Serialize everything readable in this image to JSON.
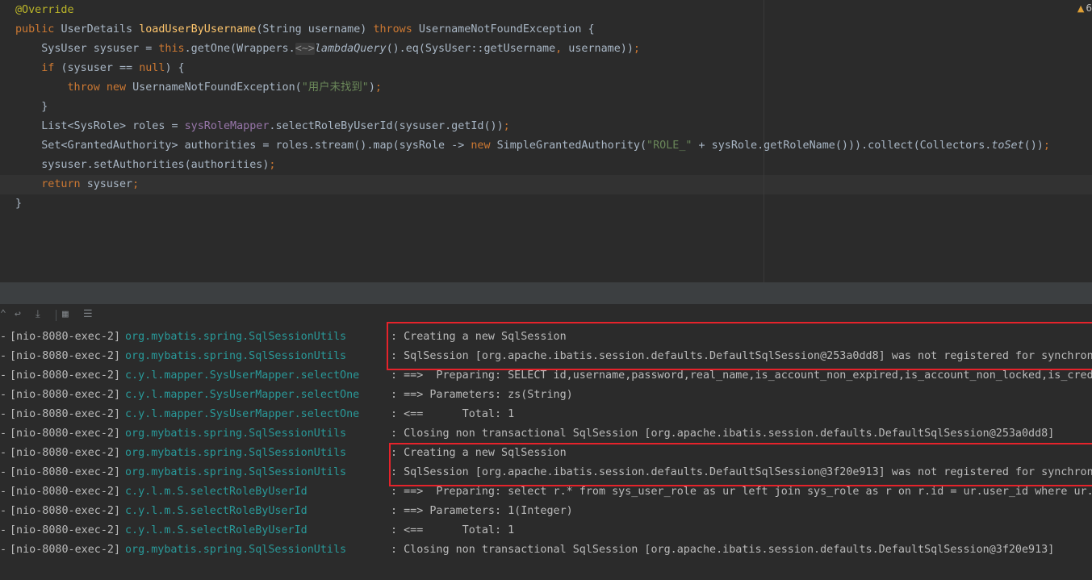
{
  "editor": {
    "inspection_count": "6",
    "code_lines": [
      [
        {
          "t": "@Override",
          "c": "tok-annotation"
        }
      ],
      [
        {
          "t": "public ",
          "c": "tok-kw"
        },
        {
          "t": "UserDetails "
        },
        {
          "t": "loadUserByUsername",
          "c": "tok-fn"
        },
        {
          "t": "(String username) "
        },
        {
          "t": "throws ",
          "c": "tok-kw"
        },
        {
          "t": "UsernameNotFoundException {"
        }
      ],
      [
        {
          "t": "    SysUser sysuser = "
        },
        {
          "t": "this",
          "c": "tok-kw"
        },
        {
          "t": ".getOne(Wrappers."
        },
        {
          "t": "<~>",
          "c": "tok-diamond"
        },
        {
          "t": "lambdaQuery",
          "c": "tok-it"
        },
        {
          "t": "().eq(SysUser::getUsername"
        },
        {
          "t": ", ",
          "c": "tok-kw"
        },
        {
          "t": "username))"
        },
        {
          "t": ";",
          "c": "tok-kw"
        }
      ],
      [
        {
          "t": "    "
        },
        {
          "t": "if ",
          "c": "tok-kw"
        },
        {
          "t": "(sysuser == "
        },
        {
          "t": "null",
          "c": "tok-kw"
        },
        {
          "t": ") {"
        }
      ],
      [
        {
          "t": "        "
        },
        {
          "t": "throw new ",
          "c": "tok-kw"
        },
        {
          "t": "UsernameNotFoundException("
        },
        {
          "t": "\"用户未找到\"",
          "c": "tok-str"
        },
        {
          "t": ")"
        },
        {
          "t": ";",
          "c": "tok-kw"
        }
      ],
      [
        {
          "t": "    }"
        }
      ],
      [
        {
          "t": "    List<SysRole> roles = "
        },
        {
          "t": "sysRoleMapper",
          "c": "tok-field"
        },
        {
          "t": ".selectRoleByUserId(sysuser.getId())"
        },
        {
          "t": ";",
          "c": "tok-kw"
        }
      ],
      [
        {
          "t": "    Set<GrantedAuthority> authorities = roles.stream().map(sysRole -> "
        },
        {
          "t": "new ",
          "c": "tok-kw"
        },
        {
          "t": "SimpleGrantedAuthority("
        },
        {
          "t": "\"ROLE_\"",
          "c": "tok-str"
        },
        {
          "t": " + sysRole.getRoleName())).collect(Collectors."
        },
        {
          "t": "toSet",
          "c": "tok-it"
        },
        {
          "t": "())"
        },
        {
          "t": ";",
          "c": "tok-kw"
        }
      ],
      [
        {
          "t": "    sysuser.setAuthorities(authorities)"
        },
        {
          "t": ";",
          "c": "tok-kw"
        }
      ],
      [
        {
          "t": "    "
        },
        {
          "t": "return ",
          "c": "tok-kw"
        },
        {
          "t": "sysuser"
        },
        {
          "t": ";",
          "c": "tok-kw"
        }
      ],
      [
        {
          "t": "}"
        }
      ]
    ]
  },
  "console": {
    "toolbar_icons": [
      "scroll-up-icon",
      "soft-wrap-icon",
      "scroll-to-end-icon",
      "print-icon",
      "clear-all-icon"
    ],
    "log_lines": [
      {
        "prefix": "-",
        "thread": "[nio-8080-exec-2]",
        "logger": "org.mybatis.spring.SqlSessionUtils",
        "message": ": Creating a new SqlSession"
      },
      {
        "prefix": "-",
        "thread": "[nio-8080-exec-2]",
        "logger": "org.mybatis.spring.SqlSessionUtils",
        "message": ": SqlSession [org.apache.ibatis.session.defaults.DefaultSqlSession@253a0dd8] was not registered for synchroni"
      },
      {
        "prefix": "-",
        "thread": "[nio-8080-exec-2]",
        "logger": "c.y.l.mapper.SysUserMapper.selectOne",
        "message": ": ==>  Preparing: SELECT id,username,password,real_name,is_account_non_expired,is_account_non_locked,is_crede"
      },
      {
        "prefix": "-",
        "thread": "[nio-8080-exec-2]",
        "logger": "c.y.l.mapper.SysUserMapper.selectOne",
        "message": ": ==> Parameters: zs(String)"
      },
      {
        "prefix": "-",
        "thread": "[nio-8080-exec-2]",
        "logger": "c.y.l.mapper.SysUserMapper.selectOne",
        "message": ": <==      Total: 1"
      },
      {
        "prefix": "-",
        "thread": "[nio-8080-exec-2]",
        "logger": "org.mybatis.spring.SqlSessionUtils",
        "message": ": Closing non transactional SqlSession [org.apache.ibatis.session.defaults.DefaultSqlSession@253a0dd8]"
      },
      {
        "prefix": "-",
        "thread": "[nio-8080-exec-2]",
        "logger": "org.mybatis.spring.SqlSessionUtils",
        "message": ": Creating a new SqlSession"
      },
      {
        "prefix": "-",
        "thread": "[nio-8080-exec-2]",
        "logger": "org.mybatis.spring.SqlSessionUtils",
        "message": ": SqlSession [org.apache.ibatis.session.defaults.DefaultSqlSession@3f20e913] was not registered for synchroni"
      },
      {
        "prefix": "-",
        "thread": "[nio-8080-exec-2]",
        "logger": "c.y.l.m.S.selectRoleByUserId",
        "message": ": ==>  Preparing: select r.* from sys_user_role as ur left join sys_role as r on r.id = ur.user_id where ur.u"
      },
      {
        "prefix": "-",
        "thread": "[nio-8080-exec-2]",
        "logger": "c.y.l.m.S.selectRoleByUserId",
        "message": ": ==> Parameters: 1(Integer)"
      },
      {
        "prefix": "-",
        "thread": "[nio-8080-exec-2]",
        "logger": "c.y.l.m.S.selectRoleByUserId",
        "message": ": <==      Total: 1"
      },
      {
        "prefix": "-",
        "thread": "[nio-8080-exec-2]",
        "logger": "org.mybatis.spring.SqlSessionUtils",
        "message": ": Closing non transactional SqlSession [org.apache.ibatis.session.defaults.DefaultSqlSession@3f20e913]"
      }
    ]
  }
}
